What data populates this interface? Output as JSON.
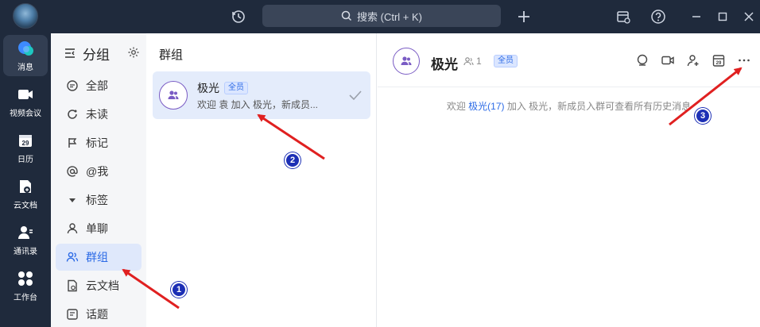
{
  "topbar": {
    "search_label": "搜索 (Ctrl + K)",
    "icons": [
      "history-icon",
      "plus-icon",
      "calendar-alert-icon",
      "help-icon",
      "minimize-icon",
      "maximize-icon",
      "close-icon"
    ]
  },
  "nav": {
    "items": [
      {
        "label": "消息",
        "icon": "message-icon",
        "active": true
      },
      {
        "label": "视频会议",
        "icon": "video-icon"
      },
      {
        "label": "日历",
        "icon": "calendar-icon",
        "day": "29"
      },
      {
        "label": "云文档",
        "icon": "cloud-doc-icon"
      },
      {
        "label": "通讯录",
        "icon": "contacts-icon"
      },
      {
        "label": "工作台",
        "icon": "workbench-icon"
      }
    ]
  },
  "groups": {
    "title": "分组",
    "items": [
      {
        "label": "全部",
        "icon": "chat-bubble-icon"
      },
      {
        "label": "未读",
        "icon": "refresh-icon"
      },
      {
        "label": "标记",
        "icon": "flag-icon"
      },
      {
        "label": "@我",
        "icon": "at-icon"
      },
      {
        "label": "标签",
        "icon": "triangle-down-icon"
      },
      {
        "label": "单聊",
        "icon": "person-icon"
      },
      {
        "label": "群组",
        "icon": "group-icon",
        "active": true
      },
      {
        "label": "云文档",
        "icon": "doc-icon"
      },
      {
        "label": "话题",
        "icon": "topic-icon"
      }
    ]
  },
  "list": {
    "title": "群组",
    "conversation": {
      "name": "极光",
      "badge": "全员",
      "preview": "欢迎 袁 加入 极光，新成员..."
    }
  },
  "chat": {
    "name": "极光",
    "member_count": "1",
    "badge": "全员",
    "system_prefix": "欢迎 ",
    "system_link": "极光(17)",
    "system_suffix": " 加入 极光，新成员入群可查看所有历史消息"
  },
  "annotations": {
    "n1": "1",
    "n2": "2",
    "n3": "3",
    "arrow_color": "#e02020"
  },
  "colors": {
    "accent": "#2b6ae6",
    "sidebar": "#1f2a3c",
    "selected": "#e4ecfb",
    "avatar_ring": "#7a5cc4"
  }
}
